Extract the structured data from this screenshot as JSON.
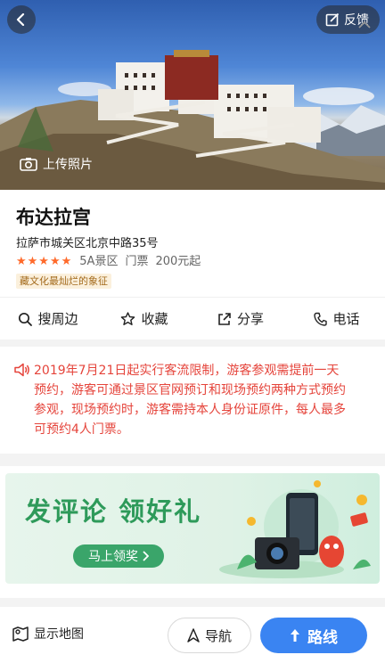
{
  "hero": {
    "upload_label": "上传照片",
    "feedback_label": "反馈"
  },
  "poi": {
    "name": "布达拉宫",
    "address": "拉萨市城关区北京中路35号",
    "rating_stars": 5,
    "stars": "★★★★★",
    "level": "5A景区",
    "ticket_label": "门票",
    "price": "200元起",
    "tag": "藏文化最灿烂的象征"
  },
  "actions": [
    {
      "label": "搜周边",
      "icon": "search-icon"
    },
    {
      "label": "收藏",
      "icon": "star-icon"
    },
    {
      "label": "分享",
      "icon": "share-icon"
    },
    {
      "label": "电话",
      "icon": "phone-icon"
    }
  ],
  "notice": {
    "text": "2019年7月21日起实行客流限制，游客参观需提前一天预约，游客可通过景区官网预订和现场预约两种方式预约参观，现场预约时，游客需持本人身份证原件，每人最多可预约4人门票。",
    "color": "#e5443b"
  },
  "banner": {
    "title": "发评论 领好礼",
    "button_label": "马上领奖",
    "accent": "#3aa56a"
  },
  "bottom": {
    "map_label": "显示地图",
    "nav_label": "导航",
    "route_label": "路线",
    "route_color": "#3a84f2"
  }
}
